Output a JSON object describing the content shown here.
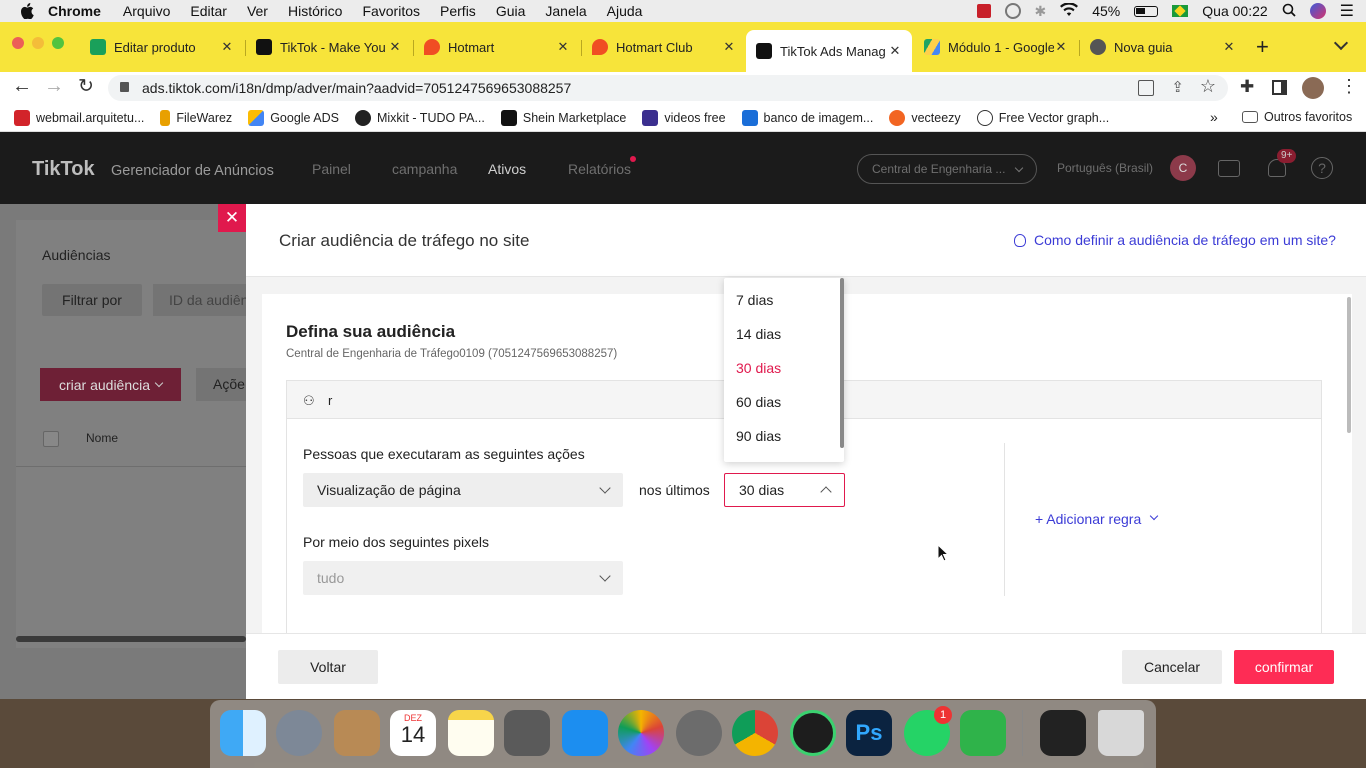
{
  "menubar": {
    "items": [
      "Chrome",
      "Arquivo",
      "Editar",
      "Ver",
      "Histórico",
      "Favoritos",
      "Perfis",
      "Guia",
      "Janela",
      "Ajuda"
    ],
    "battery": "45%",
    "clock": "Qua 00:22"
  },
  "tabs": [
    {
      "label": "Editar produto",
      "favicon_color": "#1aa05a"
    },
    {
      "label": "TikTok - Make You",
      "favicon_color": "#111111"
    },
    {
      "label": "Hotmart",
      "favicon_color": "#f04e23"
    },
    {
      "label": "Hotmart Club",
      "favicon_color": "#f04e23"
    },
    {
      "label": "TikTok Ads Manag",
      "favicon_color": "#111111"
    },
    {
      "label": "Módulo 1 - Google",
      "favicon_color": "#1fa463"
    },
    {
      "label": "Nova guia",
      "favicon_color": "#555555"
    }
  ],
  "address": {
    "url": "ads.tiktok.com/i18n/dmp/adver/main?aadvid=7051247569653088257"
  },
  "bookmarks": [
    {
      "label": "webmail.arquitetu...",
      "color": "#d2242a"
    },
    {
      "label": "FileWarez",
      "color": "#e8a000"
    },
    {
      "label": "Google ADS",
      "color": "#4285f4"
    },
    {
      "label": "Mixkit - TUDO PA...",
      "color": "#222222"
    },
    {
      "label": "Shein Marketplace",
      "color": "#111111"
    },
    {
      "label": "videos free",
      "color": "#3b2f8f"
    },
    {
      "label": "banco de imagem...",
      "color": "#1a6ed8"
    },
    {
      "label": "vecteezy",
      "color": "#f26522"
    },
    {
      "label": "Free Vector graph...",
      "color": "#333333"
    }
  ],
  "bookmarks_other": "Outros favoritos",
  "tiktok": {
    "logo": "TikTok",
    "logo_sub": "Gerenciador de Anúncios",
    "nav": [
      "Painel",
      "campanha",
      "Ativos",
      "Relatórios"
    ],
    "account_select": "Central de Engenharia ...",
    "language": "Português (Brasil)",
    "avatar": "C",
    "notif_badge": "9+"
  },
  "page": {
    "title": "Audiências",
    "filter_label": "Filtrar por",
    "id_placeholder": "ID da audiên",
    "create_button": "criar audiência",
    "actions_button": "Açõe",
    "col_name": "Nome"
  },
  "modal": {
    "title": "Criar audiência de tráfego no site",
    "help_link": "Como definir a audiência de tráfego em um site?",
    "section_title": "Defina sua audiência",
    "section_sub": "Central de Engenharia de Tráfego0109 (7051247569653088257)",
    "include_text": "r",
    "actions_label": "Pessoas que executaram as seguintes ações",
    "action_select": "Visualização de página",
    "in_last": "nos últimos",
    "days_select": "30 dias",
    "pixels_label": "Por meio dos seguintes pixels",
    "pixels_select": "tudo",
    "add_rule": "+ Adicionar regra",
    "back_button": "Voltar",
    "cancel_button": "Cancelar",
    "confirm_button": "confirmar",
    "dropdown_options": [
      "7 dias",
      "14 dias",
      "30 dias",
      "60 dias",
      "90 dias"
    ],
    "dropdown_selected": "30 dias"
  },
  "dock": {
    "calendar_month": "DEZ",
    "calendar_day": "14",
    "whatsapp_badge": "1"
  },
  "colors": {
    "accent": "#e0194d",
    "brand_red": "#fe2c55",
    "link": "#3b3bd6",
    "tabbar": "#f7e43a"
  }
}
